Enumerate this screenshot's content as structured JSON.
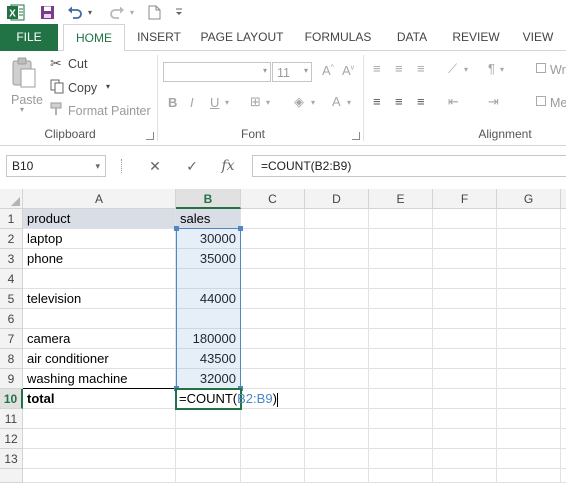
{
  "colors": {
    "brand": "#217346",
    "reference": "#4e86c6",
    "header_fill": "#d9dde5"
  },
  "quick_access": {
    "app_icon": "excel-logo-icon",
    "app_letter": "X",
    "items": [
      "save-icon",
      "undo-icon",
      "redo-icon",
      "new-document-icon",
      "customize-icon"
    ]
  },
  "tabs": [
    {
      "label": "FILE",
      "active": false
    },
    {
      "label": "HOME",
      "active": true
    },
    {
      "label": "INSERT",
      "active": false
    },
    {
      "label": "PAGE LAYOUT",
      "active": false
    },
    {
      "label": "FORMULAS",
      "active": false
    },
    {
      "label": "DATA",
      "active": false
    },
    {
      "label": "REVIEW",
      "active": false
    },
    {
      "label": "VIEW",
      "active": false
    }
  ],
  "ribbon": {
    "clipboard": {
      "paste": "Paste",
      "cut": "Cut",
      "copy": "Copy",
      "format_painter": "Format Painter",
      "group_label": "Clipboard"
    },
    "font": {
      "font_size": "11",
      "bold": "B",
      "italic": "I",
      "underline": "U",
      "group_label": "Font"
    },
    "alignment": {
      "wrap_text": "Wr",
      "merge": "Me",
      "group_label": "Alignment"
    }
  },
  "formula_bar": {
    "name_box": "B10",
    "cancel": "✕",
    "enter": "✓",
    "fx": "fx",
    "formula": "=COUNT(B2:B9)"
  },
  "grid": {
    "columns": [
      "A",
      "B",
      "C",
      "D",
      "E",
      "F",
      "G"
    ],
    "selected_column": "B",
    "rows": [
      "1",
      "2",
      "3",
      "4",
      "5",
      "6",
      "7",
      "8",
      "9",
      "10",
      "11",
      "12",
      "13"
    ],
    "active_row": "10",
    "cells": {
      "A1": "product",
      "B1": "sales",
      "A2": "laptop",
      "B2": "30000",
      "A3": "phone",
      "B3": "35000",
      "A5": "television",
      "B5": "44000",
      "A7": "camera",
      "B7": "180000",
      "A8": "air conditioner",
      "B8": "43500",
      "A9": "washing machine",
      "B9": "32000",
      "A10": "total"
    },
    "editing": {
      "prefix": "=COUNT(",
      "ref": "B2:B9",
      "suffix": ")"
    }
  }
}
